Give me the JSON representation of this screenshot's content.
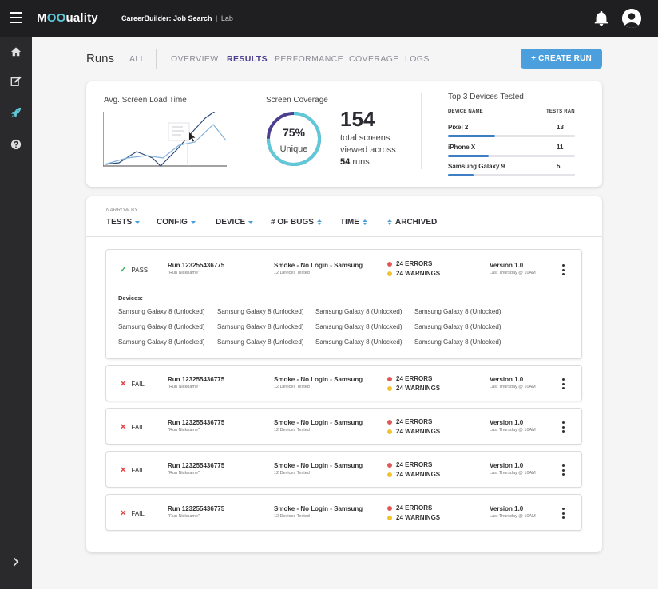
{
  "app": {
    "logo_left": "M",
    "logo_oo": "OO",
    "logo_right": "uality",
    "project_name": "CareerBuilder: Job Search",
    "project_sep": "|",
    "project_env": "Lab"
  },
  "nav": {
    "icons": [
      "home-icon",
      "edit-icon",
      "rocket-icon",
      "help-icon"
    ],
    "active": "rocket-icon",
    "accent": "#5fc9d8"
  },
  "header": {
    "title": "Runs",
    "tabs": [
      {
        "label": "ALL",
        "active": false
      },
      {
        "label": "OVERVIEW",
        "active": false
      },
      {
        "label": "RESULTS",
        "active": true
      },
      {
        "label": "PERFORMANCE",
        "active": false
      },
      {
        "label": "COVERAGE",
        "active": false
      },
      {
        "label": "LOGS",
        "active": false
      }
    ],
    "create_label": "+ CREATE RUN"
  },
  "stats": {
    "load_time_label": "Avg. Screen Load Time",
    "coverage_label": "Screen Coverage",
    "coverage_percent": "75%",
    "coverage_fraction": 0.75,
    "coverage_unique": "Unique",
    "total_screens": "154",
    "screens_line1": "total screens",
    "screens_line2": "viewed across",
    "runs_count": "54",
    "runs_word": "runs",
    "top_devices_label": "Top 3 Devices Tested",
    "device_col": "DEVICE NAME",
    "tests_col": "TESTS RAN",
    "devices": [
      {
        "name": "Pixel 2",
        "tests": "13",
        "fill": 0.37
      },
      {
        "name": "iPhone X",
        "tests": "11",
        "fill": 0.32
      },
      {
        "name": "Samsung Galaxy 9",
        "tests": "5",
        "fill": 0.2
      }
    ]
  },
  "filters": {
    "narrow_label": "NARROW BY",
    "items": [
      "TESTS",
      "CONFIG",
      "DEVICE",
      "# OF BUGS",
      "TIME",
      "ARCHIVED"
    ]
  },
  "runs": [
    {
      "status": "PASS",
      "status_icon": "check-icon",
      "name": "Run 123255436775",
      "nickname": "\"Run Nickname\"",
      "test": "Smoke - No Login - Samsung",
      "devices_tested": "12 Devices Tested",
      "errors": "24 ERRORS",
      "warnings": "24 WARNINGS",
      "version": "Version 1.0",
      "when": "Last Thursday @ 10AM",
      "devices_label": "Devices:",
      "devices": [
        "Samsung Galaxy 8 (Unlocked)",
        "Samsung Galaxy 8 (Unlocked)",
        "Samsung Galaxy 8 (Unlocked)",
        "Samsung Galaxy 8 (Unlocked)",
        "Samsung Galaxy 8 (Unlocked)",
        "Samsung Galaxy 8 (Unlocked)",
        "Samsung Galaxy 8 (Unlocked)",
        "Samsung Galaxy 8 (Unlocked)",
        "Samsung Galaxy 8 (Unlocked)",
        "Samsung Galaxy 8 (Unlocked)",
        "Samsung Galaxy 8 (Unlocked)",
        "Samsung Galaxy 8 (Unlocked)"
      ]
    },
    {
      "status": "FAIL",
      "status_icon": "x-icon",
      "name": "Run 123255436775",
      "nickname": "\"Run Nickname\"",
      "test": "Smoke - No Login - Samsung",
      "devices_tested": "12 Devices Tested",
      "errors": "24 ERRORS",
      "warnings": "24 WARNINGS",
      "version": "Version 1.0",
      "when": "Last Thursday @ 10AM"
    },
    {
      "status": "FAIL",
      "status_icon": "x-icon",
      "name": "Run 123255436775",
      "nickname": "\"Run Nickname\"",
      "test": "Smoke - No Login - Samsung",
      "devices_tested": "12 Devices Tested",
      "errors": "24 ERRORS",
      "warnings": "24 WARNINGS",
      "version": "Version 1.0",
      "when": "Last Thursday @ 10AM"
    },
    {
      "status": "FAIL",
      "status_icon": "x-icon",
      "name": "Run 123255436775",
      "nickname": "\"Run Nickname\"",
      "test": "Smoke - No Login - Samsung",
      "devices_tested": "12 Devices Tested",
      "errors": "24 ERRORS",
      "warnings": "24 WARNINGS",
      "version": "Version 1.0",
      "when": "Last Thursday @ 10AM"
    },
    {
      "status": "FAIL",
      "status_icon": "x-icon",
      "name": "Run 123255436775",
      "nickname": "\"Run Nickname\"",
      "test": "Smoke - No Login - Samsung",
      "devices_tested": "12 Devices Tested",
      "errors": "24 ERRORS",
      "warnings": "24 WARNINGS",
      "version": "Version 1.0",
      "when": "Last Thursday @ 10AM"
    }
  ],
  "colors": {
    "brand_purple": "#4b3f8f",
    "button_blue": "#4a9fdc",
    "coverage_teal": "#5fc9d8",
    "pass_green": "#2fb35c",
    "fail_red": "#e04848",
    "warning_yellow": "#f2c230"
  }
}
